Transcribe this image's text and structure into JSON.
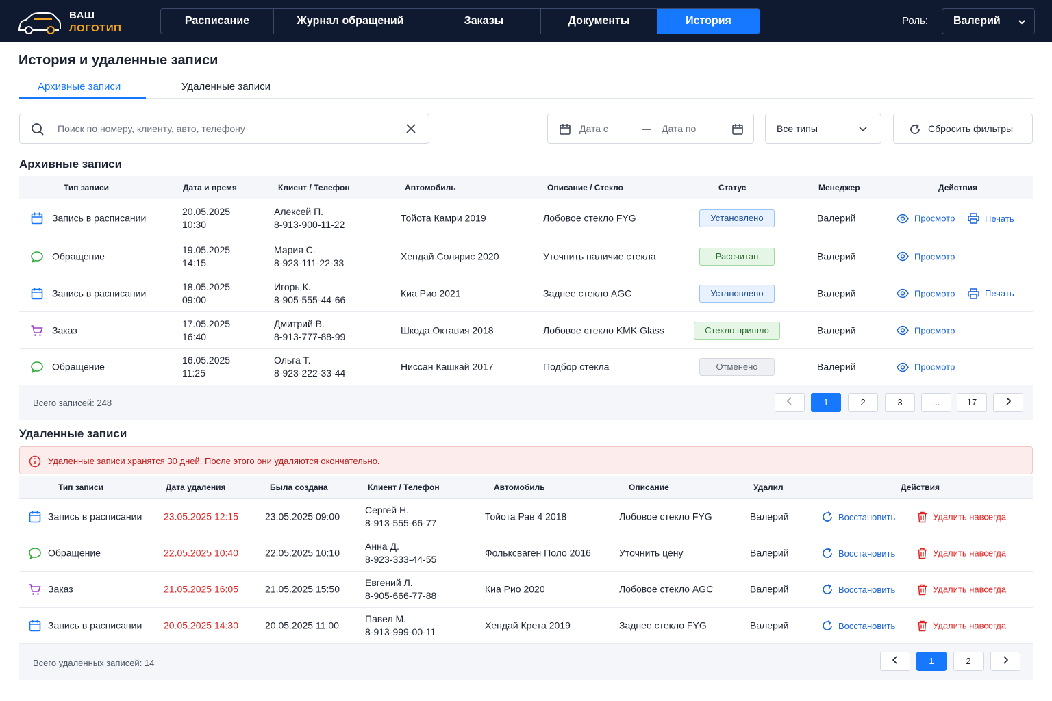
{
  "logo": {
    "line1": "ВАШ",
    "line2": "ЛОГОТИП"
  },
  "nav": {
    "tabs": [
      {
        "label": "Расписание",
        "active": false
      },
      {
        "label": "Журнал обращений",
        "active": false
      },
      {
        "label": "Заказы",
        "active": false
      },
      {
        "label": "Документы",
        "active": false
      },
      {
        "label": "История",
        "active": true
      }
    ]
  },
  "role": {
    "label": "Роль:",
    "value": "Валерий"
  },
  "page": {
    "title": "История и удаленные записи"
  },
  "subtabs": {
    "archived": "Архивные записи",
    "deleted": "Удаленные записи"
  },
  "filters": {
    "search_placeholder": "Поиск по номеру, клиенту, авто, телефону",
    "date_from": "Дата с",
    "date_to": "Дата по",
    "types": "Все типы",
    "reset": "Сбросить фильтры"
  },
  "archived": {
    "title": "Архивные записи",
    "headers": [
      "Тип записи",
      "Дата и время",
      "Клиент / Телефон",
      "Автомобиль",
      "Описание / Стекло",
      "Статус",
      "Менеджер",
      "Действия"
    ],
    "rows": [
      {
        "type": "Запись в расписании",
        "icon": "calendar-icon",
        "date": "20.05.2025",
        "time": "10:30",
        "client": "Алексей П.",
        "phone": "8-913-900-11-22",
        "car": "Тойота Камри 2019",
        "desc": "Лобовое стекло FYG",
        "status": "Установлено",
        "status_kind": "blue",
        "manager": "Валерий",
        "view": "Просмотр",
        "print": "Печать"
      },
      {
        "type": "Обращение",
        "icon": "chat-icon",
        "date": "19.05.2025",
        "time": "14:15",
        "client": "Мария С.",
        "phone": "8-923-111-22-33",
        "car": "Хендай Солярис 2020",
        "desc": "Уточнить наличие стекла",
        "status": "Рассчитан",
        "status_kind": "green",
        "manager": "Валерий",
        "view": "Просмотр",
        "print": ""
      },
      {
        "type": "Запись в расписании",
        "icon": "calendar-icon",
        "date": "18.05.2025",
        "time": "09:00",
        "client": "Игорь К.",
        "phone": "8-905-555-44-66",
        "car": "Киа Рио 2021",
        "desc": "Заднее стекло AGC",
        "status": "Установлено",
        "status_kind": "blue",
        "manager": "Валерий",
        "view": "Просмотр",
        "print": "Печать"
      },
      {
        "type": "Заказ",
        "icon": "cart-icon",
        "date": "17.05.2025",
        "time": "16:40",
        "client": "Дмитрий В.",
        "phone": "8-913-777-88-99",
        "car": "Шкода Октавия 2018",
        "desc": "Лобовое стекло KMK Glass",
        "status": "Стекло пришло",
        "status_kind": "green",
        "manager": "Валерий",
        "view": "Просмотр",
        "print": ""
      },
      {
        "type": "Обращение",
        "icon": "chat-icon",
        "date": "16.05.2025",
        "time": "11:25",
        "client": "Ольга Т.",
        "phone": "8-923-222-33-44",
        "car": "Ниссан Кашкай 2017",
        "desc": "Подбор стекла",
        "status": "Отменено",
        "status_kind": "gray",
        "manager": "Валерий",
        "view": "Просмотр",
        "print": ""
      }
    ],
    "total": "Всего записей: 248",
    "pages": [
      "1",
      "2",
      "3",
      "...",
      "17"
    ],
    "current_page": "1"
  },
  "deleted": {
    "title": "Удаленные записи",
    "alert": "Удаленные записи хранятся 30 дней. После этого они удаляются окончательно.",
    "headers": [
      "Тип записи",
      "Дата удаления",
      "Была создана",
      "Клиент / Телефон",
      "Автомобиль",
      "Описание",
      "Удалил",
      "Действия"
    ],
    "rows": [
      {
        "type": "Запись в расписании",
        "icon": "calendar-icon",
        "deleted_at": "23.05.2025 12:15",
        "created": "23.05.2025 09:00",
        "client": "Сергей Н.",
        "phone": "8-913-555-66-77",
        "car": "Тойота Рав 4 2018",
        "desc": "Лобовое стекло FYG",
        "by": "Валерий",
        "restore": "Восстановить",
        "remove": "Удалить навсегда"
      },
      {
        "type": "Обращение",
        "icon": "chat-icon",
        "deleted_at": "22.05.2025 10:40",
        "created": "22.05.2025 10:10",
        "client": "Анна Д.",
        "phone": "8-923-333-44-55",
        "car": "Фольксваген Поло 2016",
        "desc": "Уточнить цену",
        "by": "Валерий",
        "restore": "Восстановить",
        "remove": "Удалить навсегда"
      },
      {
        "type": "Заказ",
        "icon": "cart-icon",
        "deleted_at": "21.05.2025 16:05",
        "created": "21.05.2025 15:50",
        "client": "Евгений Л.",
        "phone": "8-905-666-77-88",
        "car": "Киа Рио 2020",
        "desc": "Лобовое стекло AGC",
        "by": "Валерий",
        "restore": "Восстановить",
        "remove": "Удалить навсегда"
      },
      {
        "type": "Запись в расписании",
        "icon": "calendar-icon",
        "deleted_at": "20.05.2025 14:30",
        "created": "20.05.2025 11:00",
        "client": "Павел М.",
        "phone": "8-913-999-00-11",
        "car": "Хендай Крета 2019",
        "desc": "Заднее стекло FYG",
        "by": "Валерий",
        "restore": "Восстановить",
        "remove": "Удалить навсегда"
      }
    ],
    "total": "Всего удаленных записей: 14",
    "pages": [
      "1",
      "2"
    ],
    "current_page": "1"
  },
  "colors": {
    "accent": "#1677ff",
    "nav_bg": "#0f1a30",
    "danger": "#e02424",
    "logo_accent": "#f5a623"
  }
}
